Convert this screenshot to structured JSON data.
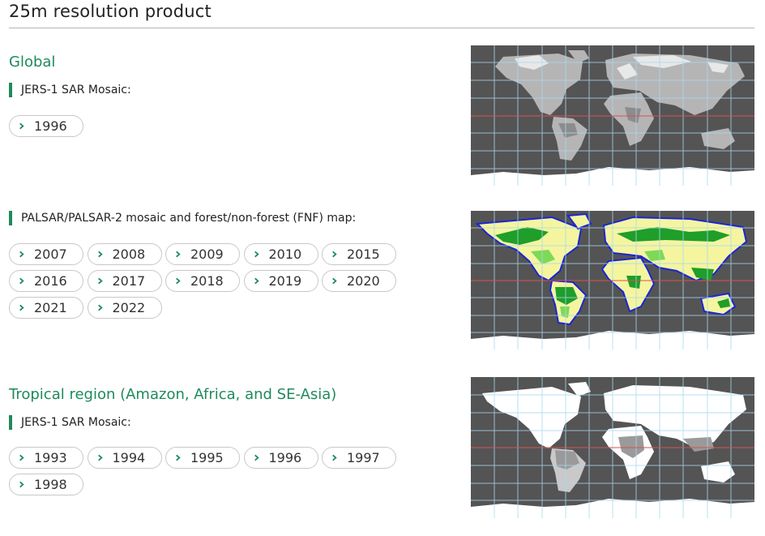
{
  "page": {
    "title": "25m resolution product"
  },
  "sections": [
    {
      "heading": "Global",
      "subsections": [
        {
          "label": "JERS-1 SAR Mosaic:",
          "years": [
            "1996"
          ]
        },
        {
          "label": "PALSAR/PALSAR-2 mosaic and forest/non-forest (FNF) map:",
          "years": [
            "2007",
            "2008",
            "2009",
            "2010",
            "2015",
            "2016",
            "2017",
            "2018",
            "2019",
            "2020",
            "2021",
            "2022"
          ]
        }
      ]
    },
    {
      "heading": "Tropical region (Amazon, Africa, and SE-Asia)",
      "subsections": [
        {
          "label": "JERS-1 SAR Mosaic:",
          "years": [
            "1993",
            "1994",
            "1995",
            "1996",
            "1997",
            "1998"
          ]
        }
      ]
    }
  ],
  "colors": {
    "accent": "#1f8a5b",
    "chevron": "#1f8a5b",
    "map_background": "#545454",
    "map_grid": "#a9d8f0",
    "map_equator": "#d9534f",
    "fnf_forest": "#1f9e2a",
    "fnf_nonforest": "#f5f5a0",
    "fnf_water_border": "#1a25d6"
  },
  "maps": [
    {
      "name": "jers1-global-map",
      "style": "sar-gray"
    },
    {
      "name": "palsar-fnf-global-map",
      "style": "fnf"
    },
    {
      "name": "jers1-tropical-map",
      "style": "white"
    }
  ]
}
